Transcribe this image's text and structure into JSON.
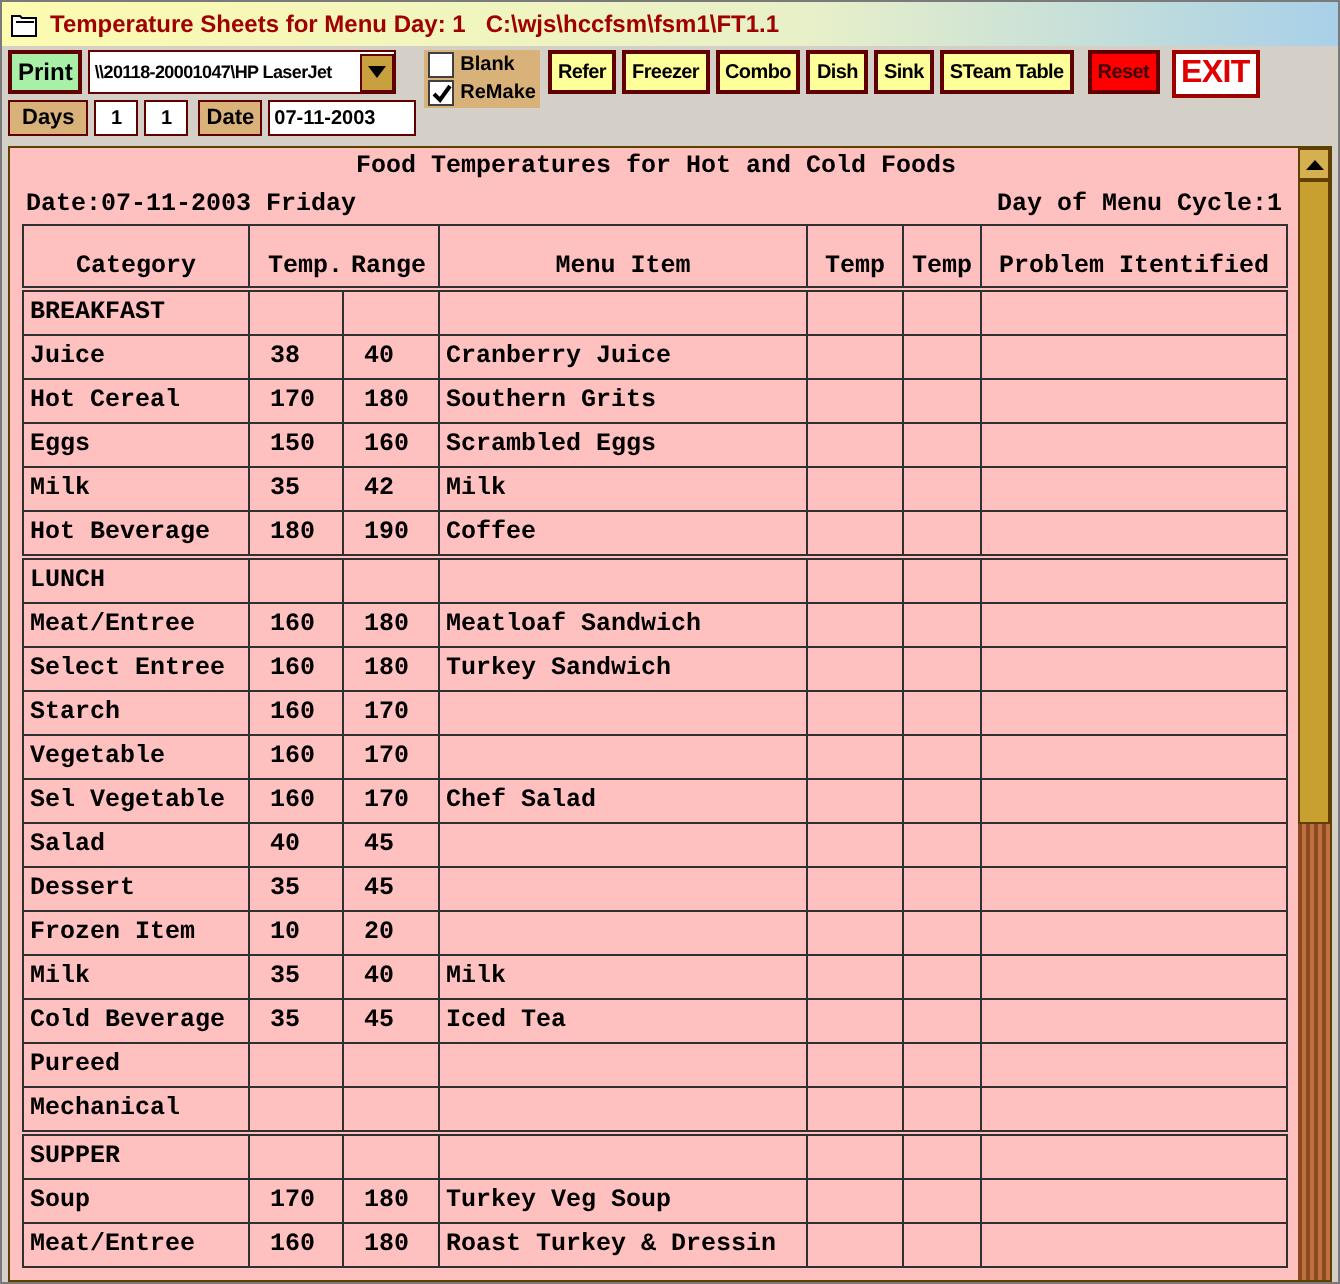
{
  "window": {
    "title": "Temperature Sheets for Menu Day: 1   C:\\wjs\\hccfsm\\fsm1\\FT1.1"
  },
  "toolbar": {
    "print_button": "Print",
    "printer": "\\\\20118-20001047\\HP LaserJet",
    "checkboxes": [
      {
        "label": "Blank",
        "checked": false
      },
      {
        "label": "ReMake",
        "checked": true
      }
    ],
    "buttons": [
      {
        "label": "Refer",
        "kind": "normal"
      },
      {
        "label": "Freezer",
        "kind": "normal"
      },
      {
        "label": "Combo",
        "kind": "normal"
      },
      {
        "label": "Dish",
        "kind": "normal"
      },
      {
        "label": "Sink",
        "kind": "normal"
      },
      {
        "label": "STeam Table",
        "kind": "normal"
      },
      {
        "label": "Reset",
        "kind": "reset"
      },
      {
        "label": "EXIT",
        "kind": "exit"
      }
    ],
    "days_label": "Days",
    "day_from": "1",
    "day_to": "1",
    "date_label": "Date",
    "date": "07-11-2003"
  },
  "sheet": {
    "title": "Food Temperatures for Hot and Cold Foods",
    "date_line": "Date:07-11-2003  Friday",
    "cycle_line": "Day of Menu Cycle:1",
    "columns": [
      "Category",
      "Temp.",
      "Range",
      "Menu Item",
      "Temp",
      "Temp",
      "Problem Itentified"
    ],
    "sections": [
      {
        "name": "BREAKFAST",
        "rows": [
          {
            "category": "Juice",
            "low": "38",
            "high": "40",
            "item": "Cranberry Juice"
          },
          {
            "category": "Hot Cereal",
            "low": "170",
            "high": "180",
            "item": "Southern Grits"
          },
          {
            "category": "Eggs",
            "low": "150",
            "high": "160",
            "item": "Scrambled Eggs"
          },
          {
            "category": "Milk",
            "low": "35",
            "high": "42",
            "item": "Milk"
          },
          {
            "category": "Hot Beverage",
            "low": "180",
            "high": "190",
            "item": "Coffee"
          }
        ]
      },
      {
        "name": "LUNCH",
        "rows": [
          {
            "category": "Meat/Entree",
            "low": "160",
            "high": "180",
            "item": "Meatloaf Sandwich"
          },
          {
            "category": "Select Entree",
            "low": "160",
            "high": "180",
            "item": "Turkey Sandwich"
          },
          {
            "category": "Starch",
            "low": "160",
            "high": "170"
          },
          {
            "category": "Vegetable",
            "low": "160",
            "high": "170"
          },
          {
            "category": "Sel Vegetable",
            "low": "160",
            "high": "170",
            "item": "Chef Salad"
          },
          {
            "category": "Salad",
            "low": "40",
            "high": "45"
          },
          {
            "category": "Dessert",
            "low": "35",
            "high": "45"
          },
          {
            "category": "Frozen Item",
            "low": "10",
            "high": "20"
          },
          {
            "category": "Milk",
            "low": "35",
            "high": "40",
            "item": "Milk"
          },
          {
            "category": "Cold Beverage",
            "low": "35",
            "high": "45",
            "item": "Iced Tea"
          },
          {
            "category": "Pureed"
          },
          {
            "category": "Mechanical"
          }
        ]
      },
      {
        "name": "SUPPER",
        "rows": [
          {
            "category": "Soup",
            "low": "170",
            "high": "180",
            "item": "Turkey Veg Soup"
          },
          {
            "category": "Meat/Entree",
            "low": "160",
            "high": "180",
            "item": "Roast Turkey & Dressin"
          }
        ]
      }
    ]
  }
}
